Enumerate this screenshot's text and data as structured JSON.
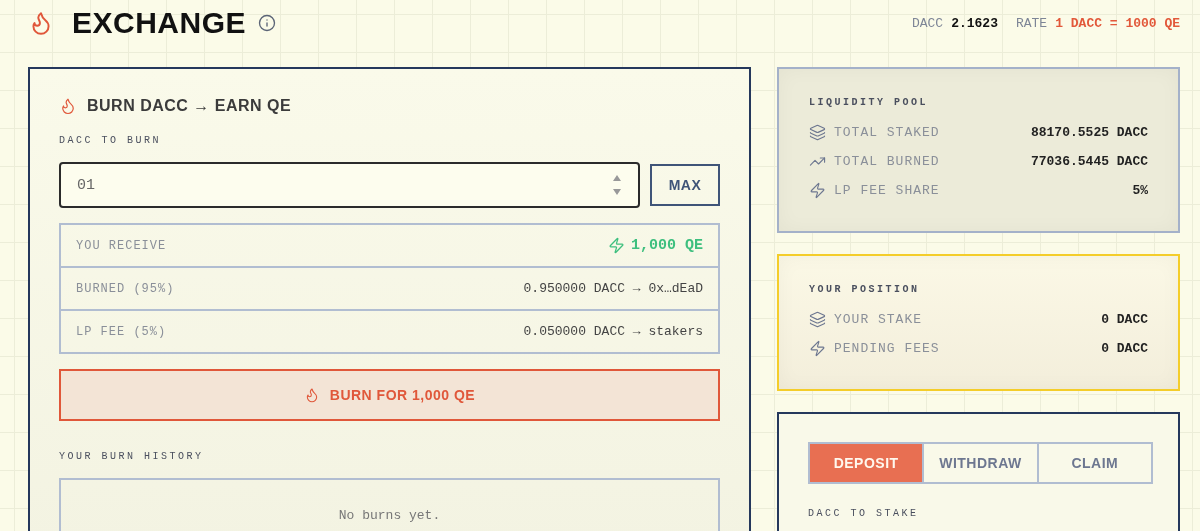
{
  "header": {
    "title": "EXCHANGE",
    "balance_label": "DACC",
    "balance": "2.1623",
    "rate_label": "RATE",
    "rate": "1 DACC = 1000 QE"
  },
  "burn": {
    "title": "BURN DACC → EARN QE",
    "input_label": "DACC TO BURN",
    "input_value": "01",
    "max_button": "MAX",
    "summary": [
      {
        "kind": "highlight",
        "label": "YOU RECEIVE",
        "value": "1,000 QE"
      },
      {
        "kind": "plain",
        "label": "BURNED (95%)",
        "value": "0.950000 DACC → 0x…dEaD"
      },
      {
        "kind": "plain",
        "label": "LP FEE (5%)",
        "value": "0.050000 DACC → stakers"
      }
    ],
    "burn_button": "BURN FOR 1,000 QE",
    "history_label": "YOUR BURN HISTORY",
    "history_empty": "No burns yet."
  },
  "pool": {
    "title": "LIQUIDITY POOL",
    "rows": [
      {
        "kind": "layers",
        "label": "TOTAL STAKED",
        "value": "88170.5525 DACC"
      },
      {
        "kind": "trend",
        "label": "TOTAL BURNED",
        "value": "77036.5445 DACC"
      },
      {
        "kind": "bolt",
        "label": "LP FEE SHARE",
        "value": "5%"
      }
    ]
  },
  "position": {
    "title": "YOUR POSITION",
    "rows": [
      {
        "kind": "layers",
        "label": "YOUR STAKE",
        "value": "0 DACC"
      },
      {
        "kind": "bolt",
        "label": "PENDING FEES",
        "value": "0 DACC"
      }
    ]
  },
  "stake": {
    "tabs": [
      {
        "label": "DEPOSIT",
        "selected": true
      },
      {
        "label": "WITHDRAW",
        "selected": false
      },
      {
        "label": "CLAIM",
        "selected": false
      }
    ],
    "input_label": "DACC TO STAKE"
  }
}
